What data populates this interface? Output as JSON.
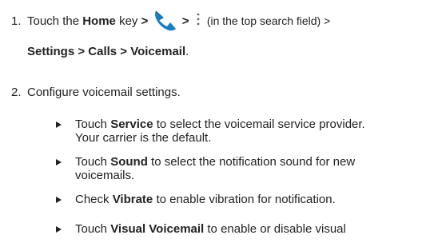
{
  "step1": {
    "number": "1.",
    "touch": "Touch the",
    "home": "Home",
    "key": "key",
    "arrow1": ">",
    "phone_icon": "phone-app-icon",
    "arrow2": ">",
    "menu_icon": "overflow-menu-icon",
    "search_note": "(in the top search field) >",
    "path": "Settings > Calls > Voicemail",
    "period": "."
  },
  "step2": {
    "number": "2.",
    "text": "Configure voicemail settings."
  },
  "bullets": [
    {
      "pre": "Touch ",
      "bold": "Service",
      "post": " to select the voicemail service provider.",
      "line2": "Your carrier is the default."
    },
    {
      "pre": "Touch ",
      "bold": "Sound",
      "post": " to select the notification sound for new",
      "line2": "voicemails."
    },
    {
      "pre": "Check ",
      "bold": "Vibrate",
      "post": " to enable vibration for notification.",
      "line2": ""
    },
    {
      "pre": "Touch ",
      "bold": "Visual Voicemail",
      "post": " to enable or disable visual",
      "line2": ""
    }
  ],
  "colors": {
    "text": "#222222",
    "icon_blue": "#1a7fc1"
  }
}
